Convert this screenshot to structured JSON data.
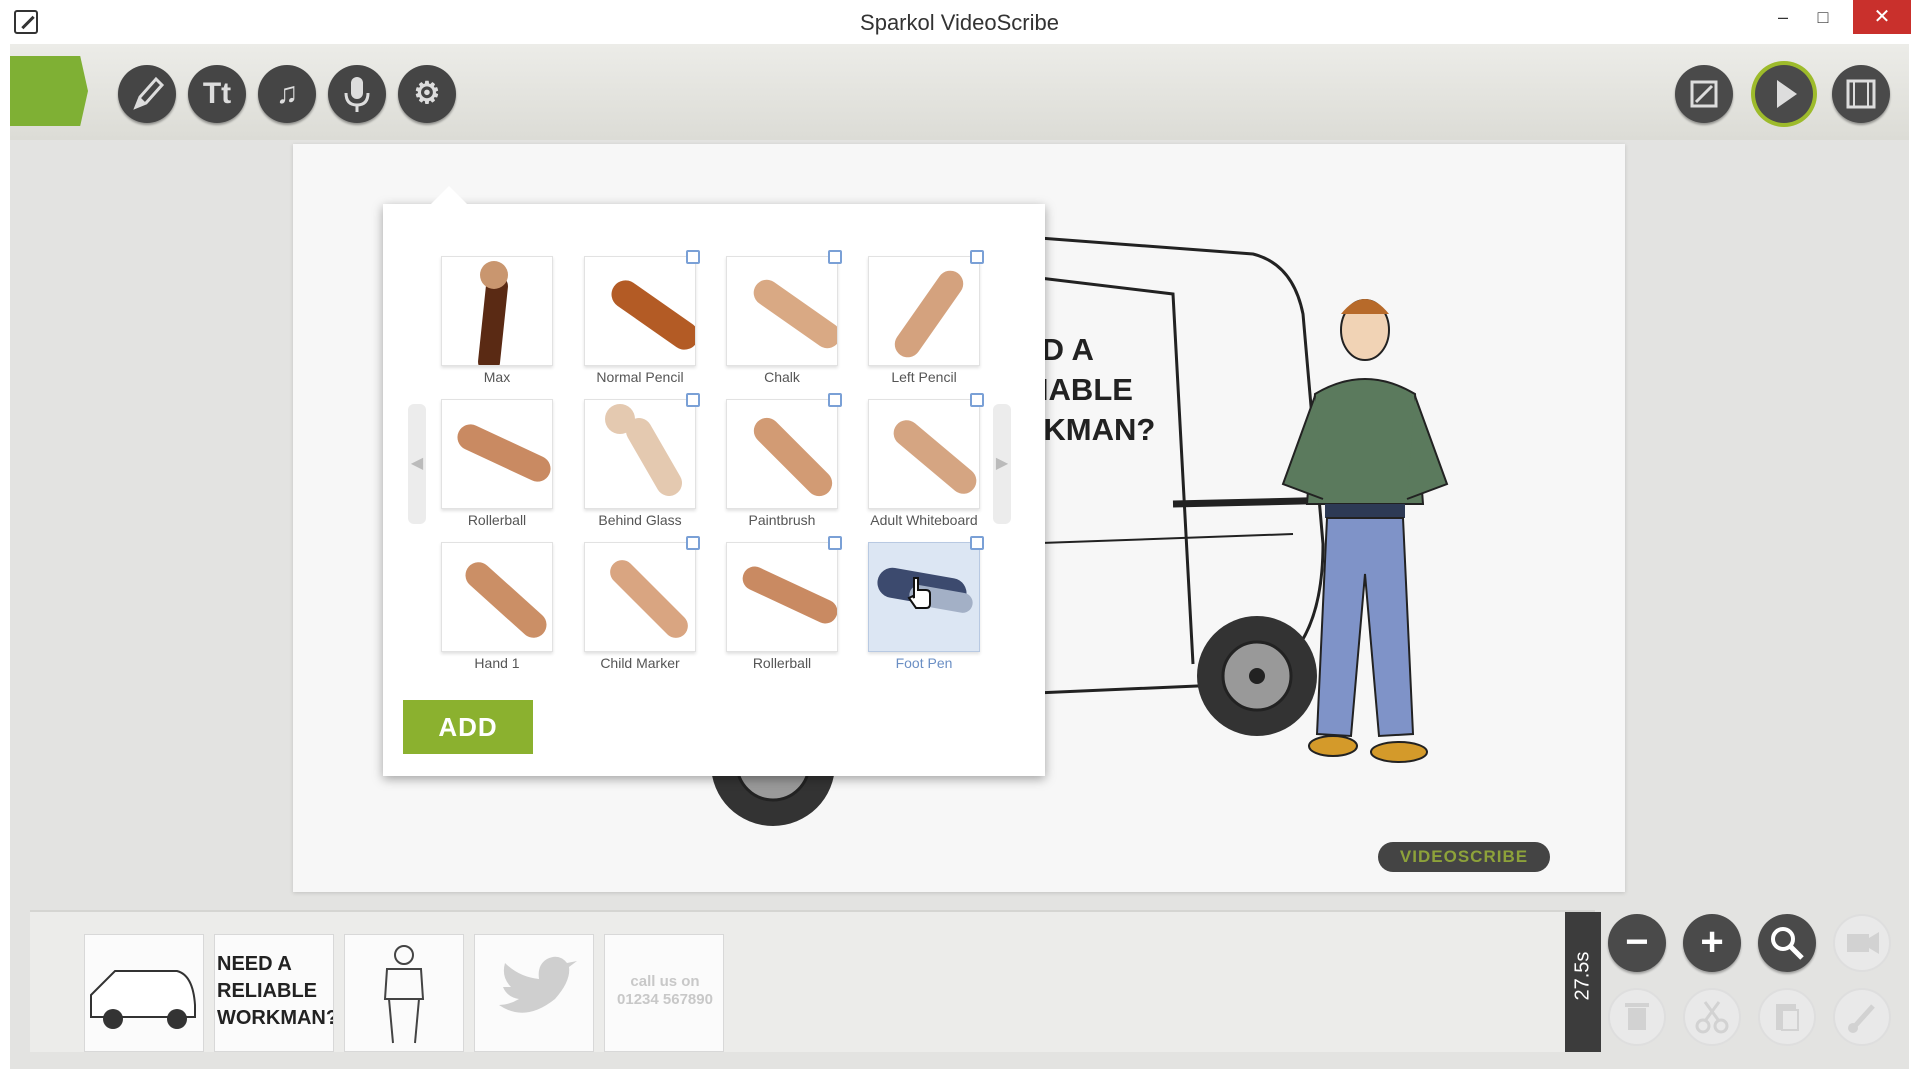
{
  "window": {
    "title": "Sparkol VideoScribe",
    "minimize": "–",
    "maximize": "□",
    "close": "✕"
  },
  "toolbar": {
    "text_tool_label": "Tt",
    "music_icon": "♫",
    "settings_icon": "⚙"
  },
  "canvas": {
    "van_text": "ED A\nLIABLE\nRKMAN?",
    "pen_logo_text": "VIDEOSCRIBE"
  },
  "hand_picker": {
    "hands": [
      {
        "label": "Max"
      },
      {
        "label": "Normal Pencil"
      },
      {
        "label": "Chalk"
      },
      {
        "label": "Left Pencil"
      },
      {
        "label": "Rollerball"
      },
      {
        "label": "Behind Glass"
      },
      {
        "label": "Paintbrush"
      },
      {
        "label": "Adult Whiteboard"
      },
      {
        "label": "Hand 1"
      },
      {
        "label": "Child Marker"
      },
      {
        "label": "Rollerball"
      },
      {
        "label": "Foot Pen"
      }
    ],
    "selected": "Foot Pen",
    "add_label": "ADD",
    "prev_arrow": "◀",
    "next_arrow": "▶"
  },
  "timeline": {
    "thumb_text": "NEED A\nRELIABLE\nWORKMAN?",
    "thumb_faded_text": "call us on\n01234 567890",
    "duration": "27.5s",
    "zoom_out": "−",
    "zoom_in": "+"
  },
  "colors": {
    "accent_green": "#8bb12f",
    "toolbar_button": "#454545",
    "close_red": "#c9302c",
    "selected_blue": "#dce6f3"
  }
}
